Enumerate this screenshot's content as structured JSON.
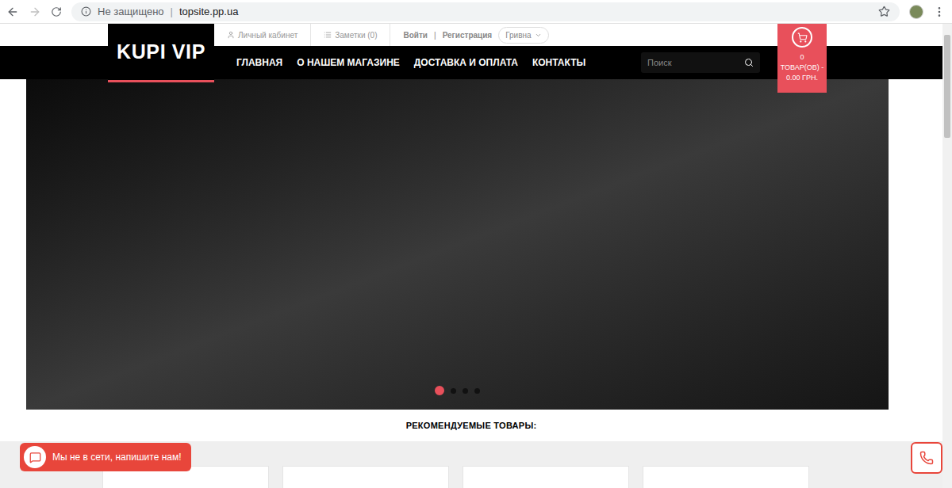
{
  "browser": {
    "security_label": "Не защищено",
    "url_separator": "|",
    "url": "topsite.pp.ua"
  },
  "logo": "KUPI VIP",
  "top_links": {
    "account": "Личный кабинет",
    "notes": "Заметки (0)",
    "login": "Войти",
    "separator": "|",
    "register": "Регистрация",
    "currency": "Гривна"
  },
  "nav": [
    {
      "label": "ГЛАВНАЯ"
    },
    {
      "label": "О НАШЕМ МАГАЗИНЕ"
    },
    {
      "label": "ДОСТАВКА И ОПЛАТА"
    },
    {
      "label": "КОНТАКТЫ"
    }
  ],
  "search": {
    "placeholder": "Поиск"
  },
  "cart": {
    "count": "0",
    "summary": "ТОВАР(ОВ) -",
    "total": "0.00 ГРН."
  },
  "slider": {
    "dots": [
      {
        "selected": true
      },
      {
        "selected": false
      },
      {
        "selected": false
      },
      {
        "selected": false
      }
    ]
  },
  "section_title": "РЕКОМЕНДУЕМЫЕ ТОВАРЫ:",
  "product_cards": [
    {
      "kind": "card"
    },
    {
      "kind": "card"
    },
    {
      "kind": "card"
    },
    {
      "kind": "card"
    }
  ],
  "chat": {
    "text": "Мы не в сети, напишите нам!"
  }
}
